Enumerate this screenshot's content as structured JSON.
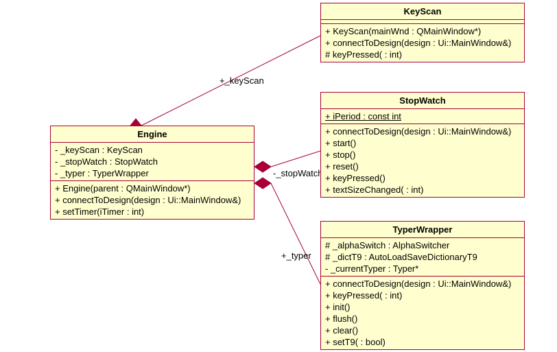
{
  "classes": {
    "engine": {
      "name": "Engine",
      "attrs": [
        "- _keyScan : KeyScan",
        "- _stopWatch : StopWatch",
        "- _typer : TyperWrapper"
      ],
      "ops": [
        "+ Engine(parent : QMainWindow*)",
        "+ connectToDesign(design : Ui::MainWindow&)",
        "+ setTimer(iTimer : int)"
      ]
    },
    "keyscan": {
      "name": "KeyScan",
      "ops": [
        "+ KeyScan(mainWnd : QMainWindow*)",
        "+ connectToDesign(design : Ui::MainWindow&)",
        "# keyPressed( : int)"
      ]
    },
    "stopwatch": {
      "name": "StopWatch",
      "attrs_static": [
        "+ iPeriod : const int"
      ],
      "ops": [
        "+ connectToDesign(design : Ui::MainWindow&)",
        "+ start()",
        "+ stop()",
        "+ reset()",
        "+ keyPressed()",
        "+ textSizeChanged( : int)"
      ]
    },
    "typerwrapper": {
      "name": "TyperWrapper",
      "attrs": [
        "# _alphaSwitch : AlphaSwitcher",
        "# _dictT9 : AutoLoadSaveDictionaryT9",
        "- _currentTyper : Typer*"
      ],
      "ops": [
        "+ connectToDesign(design : Ui::MainWindow&)",
        "+ keyPressed( : int)",
        "+ init()",
        "+ flush()",
        "+ clear()",
        "+ setT9( : bool)"
      ]
    }
  },
  "relations": {
    "keyscan": "+_keyScan",
    "stopwatch": "-_stopWatch",
    "typer": "+_typer"
  },
  "chart_data": {
    "type": "uml_class_diagram",
    "classes": [
      {
        "name": "Engine",
        "attributes": [
          {
            "vis": "-",
            "name": "_keyScan",
            "type": "KeyScan"
          },
          {
            "vis": "-",
            "name": "_stopWatch",
            "type": "StopWatch"
          },
          {
            "vis": "-",
            "name": "_typer",
            "type": "TyperWrapper"
          }
        ],
        "operations": [
          {
            "vis": "+",
            "sig": "Engine(parent : QMainWindow*)"
          },
          {
            "vis": "+",
            "sig": "connectToDesign(design : Ui::MainWindow&)"
          },
          {
            "vis": "+",
            "sig": "setTimer(iTimer : int)"
          }
        ]
      },
      {
        "name": "KeyScan",
        "attributes": [],
        "operations": [
          {
            "vis": "+",
            "sig": "KeyScan(mainWnd : QMainWindow*)"
          },
          {
            "vis": "+",
            "sig": "connectToDesign(design : Ui::MainWindow&)"
          },
          {
            "vis": "#",
            "sig": "keyPressed( : int)"
          }
        ]
      },
      {
        "name": "StopWatch",
        "attributes": [
          {
            "vis": "+",
            "name": "iPeriod",
            "type": "const int",
            "static": true
          }
        ],
        "operations": [
          {
            "vis": "+",
            "sig": "connectToDesign(design : Ui::MainWindow&)"
          },
          {
            "vis": "+",
            "sig": "start()"
          },
          {
            "vis": "+",
            "sig": "stop()"
          },
          {
            "vis": "+",
            "sig": "reset()"
          },
          {
            "vis": "+",
            "sig": "keyPressed()"
          },
          {
            "vis": "+",
            "sig": "textSizeChanged( : int)"
          }
        ]
      },
      {
        "name": "TyperWrapper",
        "attributes": [
          {
            "vis": "#",
            "name": "_alphaSwitch",
            "type": "AlphaSwitcher"
          },
          {
            "vis": "#",
            "name": "_dictT9",
            "type": "AutoLoadSaveDictionaryT9"
          },
          {
            "vis": "-",
            "name": "_currentTyper",
            "type": "Typer*"
          }
        ],
        "operations": [
          {
            "vis": "+",
            "sig": "connectToDesign(design : Ui::MainWindow&)"
          },
          {
            "vis": "+",
            "sig": "keyPressed( : int)"
          },
          {
            "vis": "+",
            "sig": "init()"
          },
          {
            "vis": "+",
            "sig": "flush()"
          },
          {
            "vis": "+",
            "sig": "clear()"
          },
          {
            "vis": "+",
            "sig": "setT9( : bool)"
          }
        ]
      }
    ],
    "relations": [
      {
        "from": "Engine",
        "to": "KeyScan",
        "kind": "composition",
        "label": "+_keyScan"
      },
      {
        "from": "Engine",
        "to": "StopWatch",
        "kind": "composition",
        "label": "-_stopWatch"
      },
      {
        "from": "Engine",
        "to": "TyperWrapper",
        "kind": "composition",
        "label": "+_typer"
      }
    ]
  }
}
